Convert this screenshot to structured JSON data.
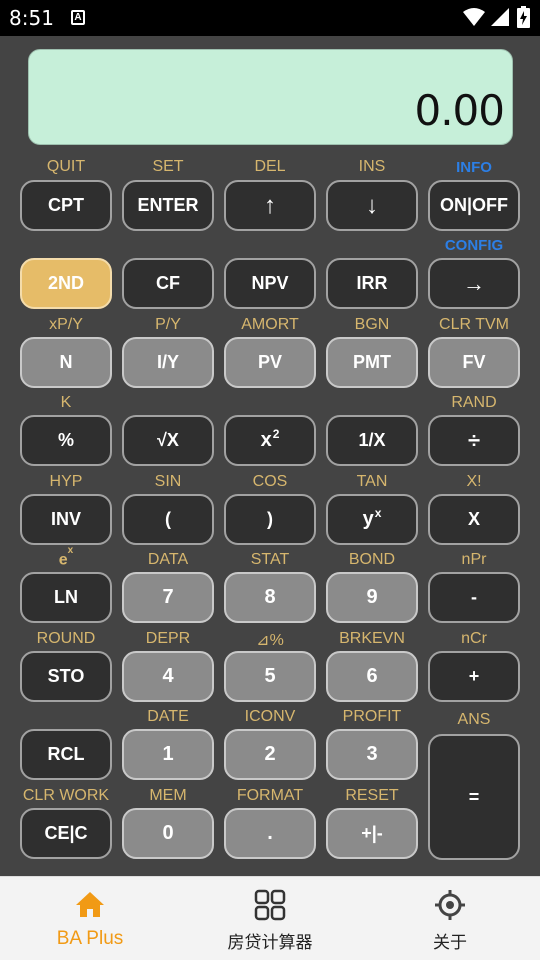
{
  "status_bar": {
    "time": "8:51",
    "notification_icon": "A"
  },
  "display": {
    "value": "0.00"
  },
  "rows": [
    {
      "labels": [
        "QUIT",
        "SET",
        "DEL",
        "INS",
        "INFO"
      ],
      "keys": [
        "CPT",
        "ENTER",
        "↑",
        "↓",
        "ON|OFF"
      ]
    },
    {
      "labels": [
        "",
        "",
        "",
        "",
        "CONFIG"
      ],
      "keys": [
        "2ND",
        "CF",
        "NPV",
        "IRR",
        "→"
      ]
    },
    {
      "labels": [
        "xP/Y",
        "P/Y",
        "AMORT",
        "BGN",
        "CLR TVM"
      ],
      "keys": [
        "N",
        "I/Y",
        "PV",
        "PMT",
        "FV"
      ]
    },
    {
      "labels": [
        "K",
        "",
        "",
        "",
        "RAND"
      ],
      "keys": [
        "%",
        "√X",
        "x",
        "1/X",
        "÷"
      ]
    },
    {
      "labels": [
        "HYP",
        "SIN",
        "COS",
        "TAN",
        "X!"
      ],
      "keys": [
        "INV",
        "(",
        ")",
        "y",
        "X"
      ]
    },
    {
      "labels": [
        "e",
        "DATA",
        "STAT",
        "BOND",
        "nPr"
      ],
      "keys": [
        "LN",
        "7",
        "8",
        "9",
        "-"
      ]
    },
    {
      "labels": [
        "ROUND",
        "DEPR",
        "⊿%",
        "BRKEVN",
        "nCr"
      ],
      "keys": [
        "STO",
        "4",
        "5",
        "6",
        "+"
      ]
    },
    {
      "labels": [
        "",
        "DATE",
        "ICONV",
        "PROFIT",
        "ANS"
      ],
      "keys": [
        "RCL",
        "1",
        "2",
        "3",
        "="
      ]
    },
    {
      "labels": [
        "CLR WORK",
        "MEM",
        "FORMAT",
        "RESET"
      ],
      "keys": [
        "CE|C",
        "0",
        ".",
        "+|-"
      ]
    }
  ],
  "superscripts": {
    "x_squared": "2",
    "y_power": "x",
    "e_power": "x"
  },
  "bottom_nav": [
    {
      "label": "BA Plus",
      "icon": "home-icon",
      "active": true
    },
    {
      "label": "房贷计算器",
      "icon": "grid-icon",
      "active": false
    },
    {
      "label": "关于",
      "icon": "target-icon",
      "active": false
    }
  ],
  "colors": {
    "accent": "#f19a15",
    "second_key": "#e6bc68",
    "display": "#c6efd9",
    "label_gold": "#d6b66e",
    "label_blue": "#2c7fe6"
  }
}
